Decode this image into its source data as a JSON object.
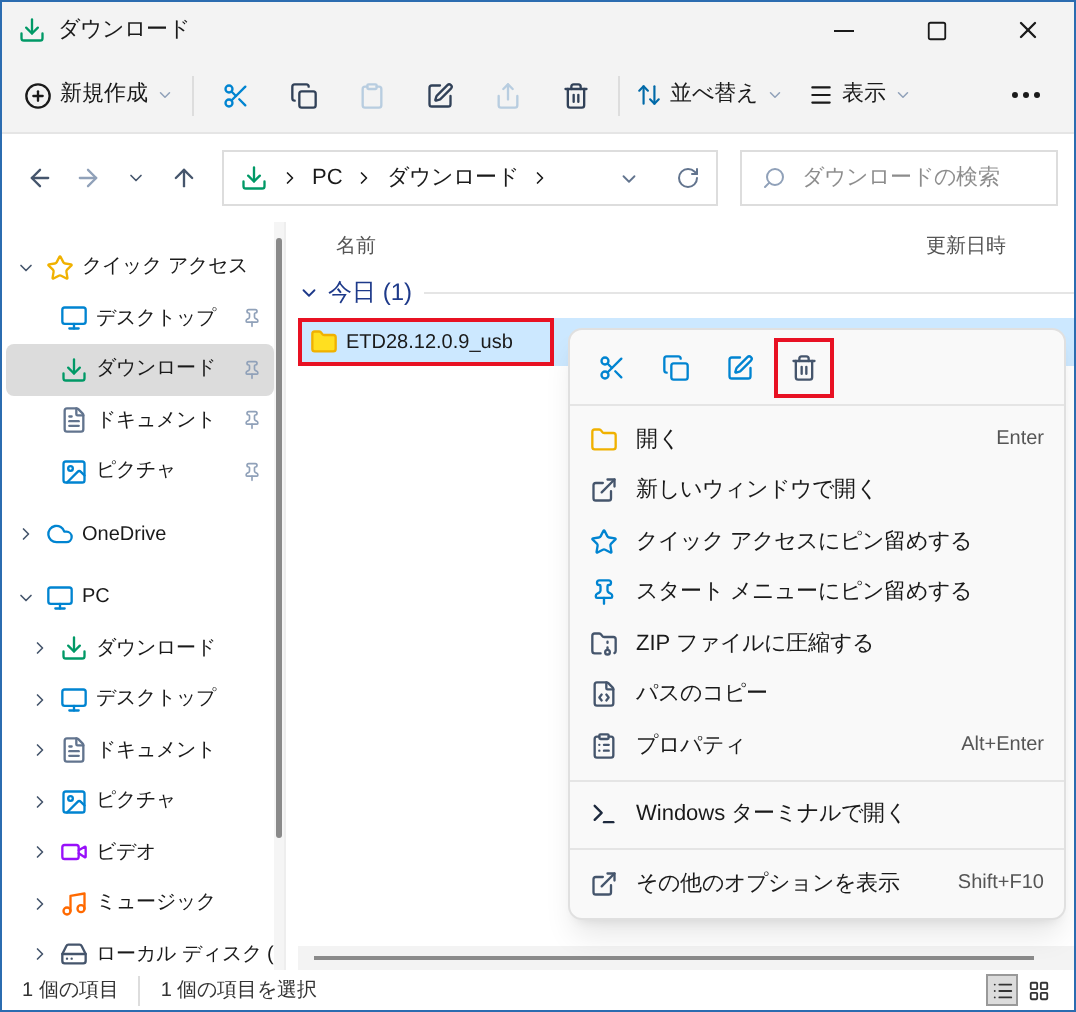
{
  "window": {
    "title": "ダウンロード"
  },
  "toolbar": {
    "new_button": {
      "label": "新規作成"
    },
    "icon_buttons": [
      {
        "disabled": false
      },
      {
        "disabled": false
      },
      {
        "disabled": true
      },
      {
        "disabled": false
      },
      {
        "disabled": true
      },
      {
        "disabled": false
      }
    ],
    "sort_button": {
      "label": "並べ替え"
    },
    "view_button": {
      "label": "表示"
    }
  },
  "address": {
    "path": [
      "PC",
      "ダウンロード"
    ]
  },
  "search": {
    "placeholder": "ダウンロードの検索"
  },
  "sidebar": {
    "items": [
      {
        "label": "クイック アクセス",
        "expanded": true,
        "selected": false,
        "children": [
          {
            "label": "デスクトップ",
            "pinned": true,
            "selected": false
          },
          {
            "label": "ダウンロード",
            "pinned": true,
            "selected": true
          },
          {
            "label": "ドキュメント",
            "pinned": true,
            "selected": false
          },
          {
            "label": "ピクチャ",
            "pinned": true,
            "selected": false
          }
        ]
      },
      {
        "label": "OneDrive",
        "expanded": false,
        "selected": false
      },
      {
        "label": "PC",
        "expanded": true,
        "selected": false,
        "children": [
          {
            "label": "ダウンロード",
            "expanded": false,
            "selected": false
          },
          {
            "label": "デスクトップ",
            "expanded": false,
            "selected": false
          },
          {
            "label": "ドキュメント",
            "expanded": false,
            "selected": false
          },
          {
            "label": "ピクチャ",
            "expanded": false,
            "selected": false
          },
          {
            "label": "ビデオ",
            "expanded": false,
            "selected": false
          },
          {
            "label": "ミュージック",
            "expanded": false,
            "selected": false
          },
          {
            "label": "ローカル ディスク (",
            "expanded": false,
            "selected": false
          }
        ]
      }
    ]
  },
  "columns": [
    "名前",
    "更新日時"
  ],
  "groups": [
    {
      "label": "今日 (1)",
      "expanded": true,
      "files": [
        {
          "name": "ETD28.12.0.9_usb",
          "selected": true,
          "highlighted": true
        }
      ]
    }
  ],
  "context_menu": {
    "quick_actions": [
      {
        "highlighted": false
      },
      {
        "highlighted": false
      },
      {
        "highlighted": false
      },
      {
        "highlighted": true
      }
    ],
    "sections": [
      [
        {
          "label": "開く",
          "shortcut": "Enter"
        },
        {
          "label": "新しいウィンドウで開く"
        },
        {
          "label": "クイック アクセスにピン留めする"
        },
        {
          "label": "スタート メニューにピン留めする"
        },
        {
          "label": "ZIP ファイルに圧縮する"
        },
        {
          "label": "パスのコピー"
        },
        {
          "label": "プロパティ",
          "shortcut": "Alt+Enter"
        }
      ],
      [
        {
          "label": "Windows ターミナルで開く"
        }
      ],
      [
        {
          "label": "その他のオプションを表示",
          "shortcut": "Shift+F10"
        }
      ]
    ]
  },
  "status_bar": {
    "items": [
      "1 個の項目",
      "1 個の項目を選択"
    ],
    "view_modes": [
      {
        "selected": true
      },
      {
        "selected": false
      }
    ]
  }
}
